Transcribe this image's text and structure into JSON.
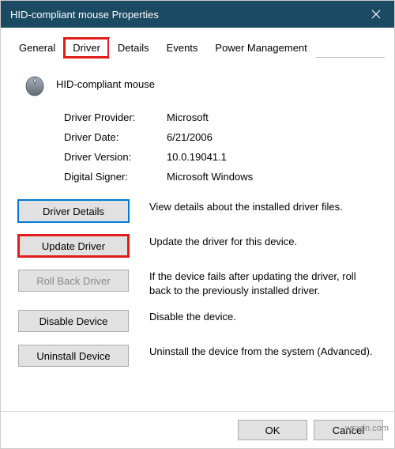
{
  "titlebar": {
    "title": "HID-compliant mouse Properties"
  },
  "tabs": {
    "general": "General",
    "driver": "Driver",
    "details": "Details",
    "events": "Events",
    "power": "Power Management"
  },
  "device": {
    "name": "HID-compliant mouse"
  },
  "info": {
    "provider_label": "Driver Provider:",
    "provider_value": "Microsoft",
    "date_label": "Driver Date:",
    "date_value": "6/21/2006",
    "version_label": "Driver Version:",
    "version_value": "10.0.19041.1",
    "signer_label": "Digital Signer:",
    "signer_value": "Microsoft Windows"
  },
  "buttons": {
    "details": {
      "label": "Driver Details",
      "desc": "View details about the installed driver files."
    },
    "update": {
      "label": "Update Driver",
      "desc": "Update the driver for this device."
    },
    "rollback": {
      "label": "Roll Back Driver",
      "desc": "If the device fails after updating the driver, roll back to the previously installed driver."
    },
    "disable": {
      "label": "Disable Device",
      "desc": "Disable the device."
    },
    "uninstall": {
      "label": "Uninstall Device",
      "desc": "Uninstall the device from the system (Advanced)."
    }
  },
  "footer": {
    "ok": "OK",
    "cancel": "Cancel"
  },
  "watermark": "wsxdn.com"
}
